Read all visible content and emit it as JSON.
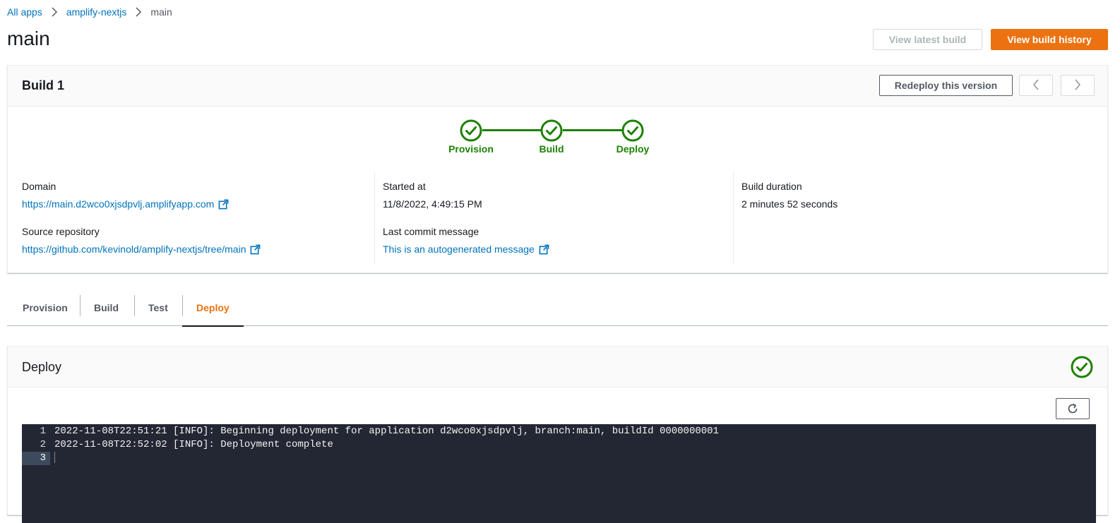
{
  "breadcrumb": {
    "items": [
      "All apps",
      "amplify-nextjs"
    ],
    "current": "main"
  },
  "page": {
    "title": "main",
    "view_latest_build": "View latest build",
    "view_build_history": "View build history"
  },
  "build": {
    "title": "Build 1",
    "redeploy_label": "Redeploy this version",
    "steps": [
      "Provision",
      "Build",
      "Deploy"
    ],
    "domain_label": "Domain",
    "domain_value": "https://main.d2wco0xjsdpvlj.amplifyapp.com",
    "source_label": "Source repository",
    "source_value": "https://github.com/kevinold/amplify-nextjs/tree/main",
    "started_label": "Started at",
    "started_value": "11/8/2022, 4:49:15 PM",
    "commit_label": "Last commit message",
    "commit_value": "This is an autogenerated message",
    "duration_label": "Build duration",
    "duration_value": "2 minutes 52 seconds"
  },
  "tabs": [
    "Provision",
    "Build",
    "Test",
    "Deploy"
  ],
  "active_tab": "Deploy",
  "deploy_panel": {
    "title": "Deploy",
    "log_lines": [
      {
        "num": "1",
        "text": "2022-11-08T22:51:21 [INFO]: Beginning deployment for application d2wco0xjsdpvlj, branch:main, buildId 0000000001"
      },
      {
        "num": "2",
        "text": "2022-11-08T22:52:02 [INFO]: Deployment complete"
      },
      {
        "num": "3",
        "text": ""
      }
    ]
  },
  "colors": {
    "link": "#0073bb",
    "primary": "#ec7211",
    "success": "#1d8102",
    "log_bg": "#232733"
  },
  "icons": {
    "breadcrumb_separator": "chevron-right-icon",
    "external_link": "external-link-icon",
    "step_status": "success-check-icon",
    "refresh": "refresh-icon",
    "prev": "chevron-left-icon",
    "next": "chevron-right-icon"
  }
}
